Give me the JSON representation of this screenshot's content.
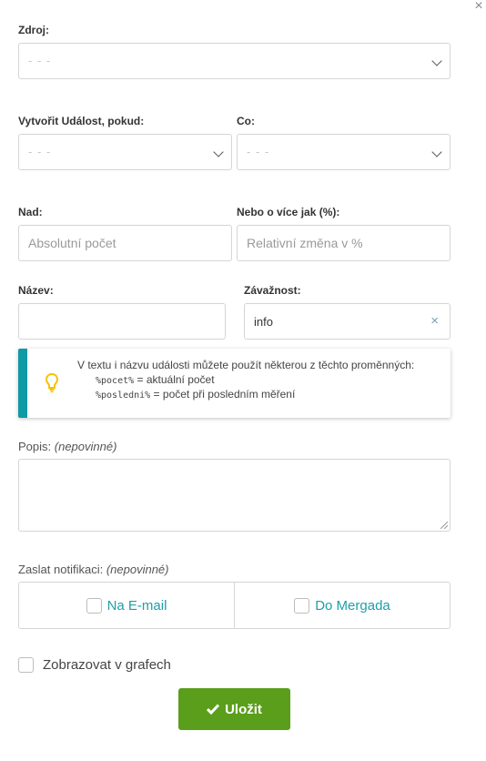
{
  "dialog": {
    "close_icon": "×"
  },
  "source": {
    "label": "Zdroj:",
    "value": "- - -"
  },
  "condition": {
    "label": "Vytvořit Událost, pokud:",
    "value": "- - -"
  },
  "what": {
    "label": "Co:",
    "value": "- - -"
  },
  "above": {
    "label": "Nad:",
    "placeholder": "Absolutní počet"
  },
  "or_more": {
    "label": "Nebo o více jak (%):",
    "placeholder": "Relativní změna v %"
  },
  "name": {
    "label": "Název:",
    "value": ""
  },
  "severity": {
    "label": "Závažnost:",
    "value": "info",
    "clear_icon": "×"
  },
  "info": {
    "line1": "V textu i názvu události můžete použít některou z těchto proměnných:",
    "var1_code": "%pocet%",
    "var1_text": " = aktuální počet",
    "var2_code": "%posledni%",
    "var2_text": " = počet při posledním měření",
    "icon": "lightbulb-icon"
  },
  "description": {
    "label": "Popis:",
    "optional": "(nepovinné)"
  },
  "notification": {
    "label": "Zaslat notifikaci:",
    "optional": "(nepovinné)",
    "options": [
      "Na E-mail",
      "Do Mergada"
    ]
  },
  "graphs": {
    "label": "Zobrazovat v grafech"
  },
  "save": {
    "label": "Uložit"
  },
  "colors": {
    "accent": "#1e9ea8",
    "save": "#5a9e1c",
    "info_bar": "#0f9aa5",
    "bulb": "#f5c400"
  }
}
